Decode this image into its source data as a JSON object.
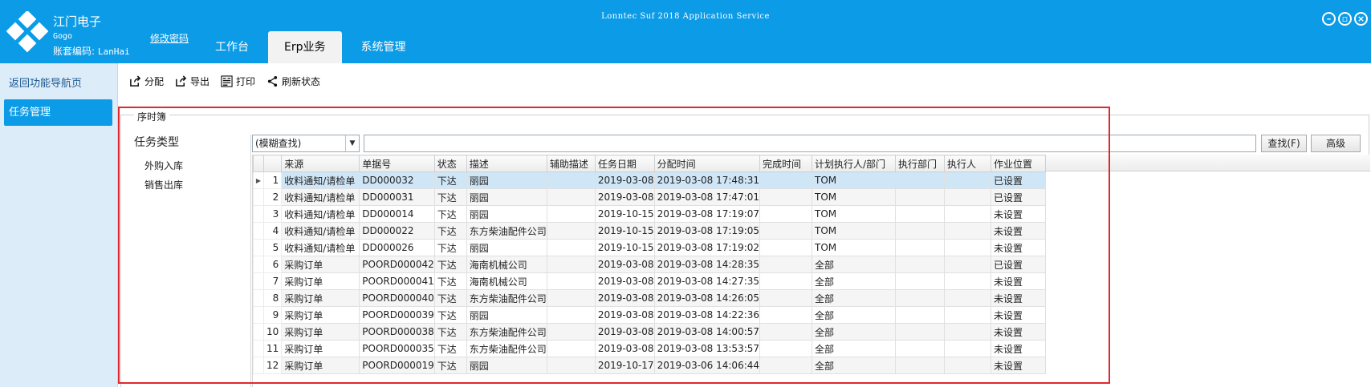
{
  "header": {
    "company": "江门电子",
    "code": "Gogo",
    "account_label": "账套编码:",
    "account_value": "LanHai",
    "change_password": "修改密码",
    "app_title": "Lonntec Suf 2018 Application Service",
    "tabs": [
      {
        "label": "工作台",
        "active": false
      },
      {
        "label": "Erp业务",
        "active": true
      },
      {
        "label": "系统管理",
        "active": false
      }
    ],
    "window_buttons": [
      "minimize-icon",
      "restore-icon",
      "close-icon"
    ]
  },
  "sidebar": {
    "back": "返回功能导航页",
    "task_management": "任务管理"
  },
  "toolbar": {
    "items": [
      {
        "label": "分配",
        "icon": "share-out-icon"
      },
      {
        "label": "导出",
        "icon": "export-icon"
      },
      {
        "label": "打印",
        "icon": "print-icon"
      },
      {
        "label": "刷新状态",
        "icon": "share-icon"
      }
    ]
  },
  "panel": {
    "group_title": "序时簿",
    "task_type_title": "任务类型",
    "task_types": [
      "外购入库",
      "销售出库"
    ]
  },
  "search": {
    "mode": "(模糊查找)",
    "query": "",
    "find_button": "查找(F)",
    "advanced_button": "高级"
  },
  "grid": {
    "columns": [
      "来源",
      "单据号",
      "状态",
      "描述",
      "辅助描述",
      "任务日期",
      "分配时间",
      "完成时间",
      "计划执行人/部门",
      "执行部门",
      "执行人",
      "作业位置"
    ],
    "selected_row": 1,
    "rows": [
      {
        "no": "1",
        "source": "收料通知/请检单",
        "doc": "DD000032",
        "status": "下达",
        "desc": "丽园",
        "aux": "",
        "date": "2019-03-08",
        "assigned": "2019-03-08 17:48:31",
        "done": "",
        "plan": "TOM",
        "dept": "",
        "exec": "",
        "loc": "已设置"
      },
      {
        "no": "2",
        "source": "收料通知/请检单",
        "doc": "DD000031",
        "status": "下达",
        "desc": "丽园",
        "aux": "",
        "date": "2019-03-08",
        "assigned": "2019-03-08 17:47:01",
        "done": "",
        "plan": "TOM",
        "dept": "",
        "exec": "",
        "loc": "已设置"
      },
      {
        "no": "3",
        "source": "收料通知/请检单",
        "doc": "DD000014",
        "status": "下达",
        "desc": "丽园",
        "aux": "",
        "date": "2019-10-15",
        "assigned": "2019-03-08 17:19:07",
        "done": "",
        "plan": "TOM",
        "dept": "",
        "exec": "",
        "loc": "未设置"
      },
      {
        "no": "4",
        "source": "收料通知/请检单",
        "doc": "DD000022",
        "status": "下达",
        "desc": "东方柴油配件公司",
        "aux": "",
        "date": "2019-10-15",
        "assigned": "2019-03-08 17:19:05",
        "done": "",
        "plan": "TOM",
        "dept": "",
        "exec": "",
        "loc": "未设置"
      },
      {
        "no": "5",
        "source": "收料通知/请检单",
        "doc": "DD000026",
        "status": "下达",
        "desc": "丽园",
        "aux": "",
        "date": "2019-10-15",
        "assigned": "2019-03-08 17:19:02",
        "done": "",
        "plan": "TOM",
        "dept": "",
        "exec": "",
        "loc": "未设置"
      },
      {
        "no": "6",
        "source": "采购订单",
        "doc": "POORD000042",
        "status": "下达",
        "desc": "海南机械公司",
        "aux": "",
        "date": "2019-03-08",
        "assigned": "2019-03-08 14:28:35",
        "done": "",
        "plan": "全部",
        "dept": "",
        "exec": "",
        "loc": "已设置"
      },
      {
        "no": "7",
        "source": "采购订单",
        "doc": "POORD000041",
        "status": "下达",
        "desc": "海南机械公司",
        "aux": "",
        "date": "2019-03-08",
        "assigned": "2019-03-08 14:27:35",
        "done": "",
        "plan": "全部",
        "dept": "",
        "exec": "",
        "loc": "未设置"
      },
      {
        "no": "8",
        "source": "采购订单",
        "doc": "POORD000040",
        "status": "下达",
        "desc": "东方柴油配件公司",
        "aux": "",
        "date": "2019-03-08",
        "assigned": "2019-03-08 14:26:05",
        "done": "",
        "plan": "全部",
        "dept": "",
        "exec": "",
        "loc": "未设置"
      },
      {
        "no": "9",
        "source": "采购订单",
        "doc": "POORD000039",
        "status": "下达",
        "desc": "丽园",
        "aux": "",
        "date": "2019-03-08",
        "assigned": "2019-03-08 14:22:36",
        "done": "",
        "plan": "全部",
        "dept": "",
        "exec": "",
        "loc": "未设置"
      },
      {
        "no": "10",
        "source": "采购订单",
        "doc": "POORD000038",
        "status": "下达",
        "desc": "东方柴油配件公司",
        "aux": "",
        "date": "2019-03-08",
        "assigned": "2019-03-08 14:00:57",
        "done": "",
        "plan": "全部",
        "dept": "",
        "exec": "",
        "loc": "未设置"
      },
      {
        "no": "11",
        "source": "采购订单",
        "doc": "POORD000035",
        "status": "下达",
        "desc": "东方柴油配件公司",
        "aux": "",
        "date": "2019-03-08",
        "assigned": "2019-03-08 13:53:57",
        "done": "",
        "plan": "全部",
        "dept": "",
        "exec": "",
        "loc": "未设置"
      },
      {
        "no": "12",
        "source": "采购订单",
        "doc": "POORD000019",
        "status": "下达",
        "desc": "丽园",
        "aux": "",
        "date": "2019-10-17",
        "assigned": "2019-03-06 14:06:44",
        "done": "",
        "plan": "全部",
        "dept": "",
        "exec": "",
        "loc": "未设置"
      }
    ]
  },
  "colors": {
    "header_blue": "#0c9be6",
    "sidebar_bg": "#ddecf9",
    "selected_row": "#cfe6f7",
    "highlight_red": "#e0282e"
  }
}
